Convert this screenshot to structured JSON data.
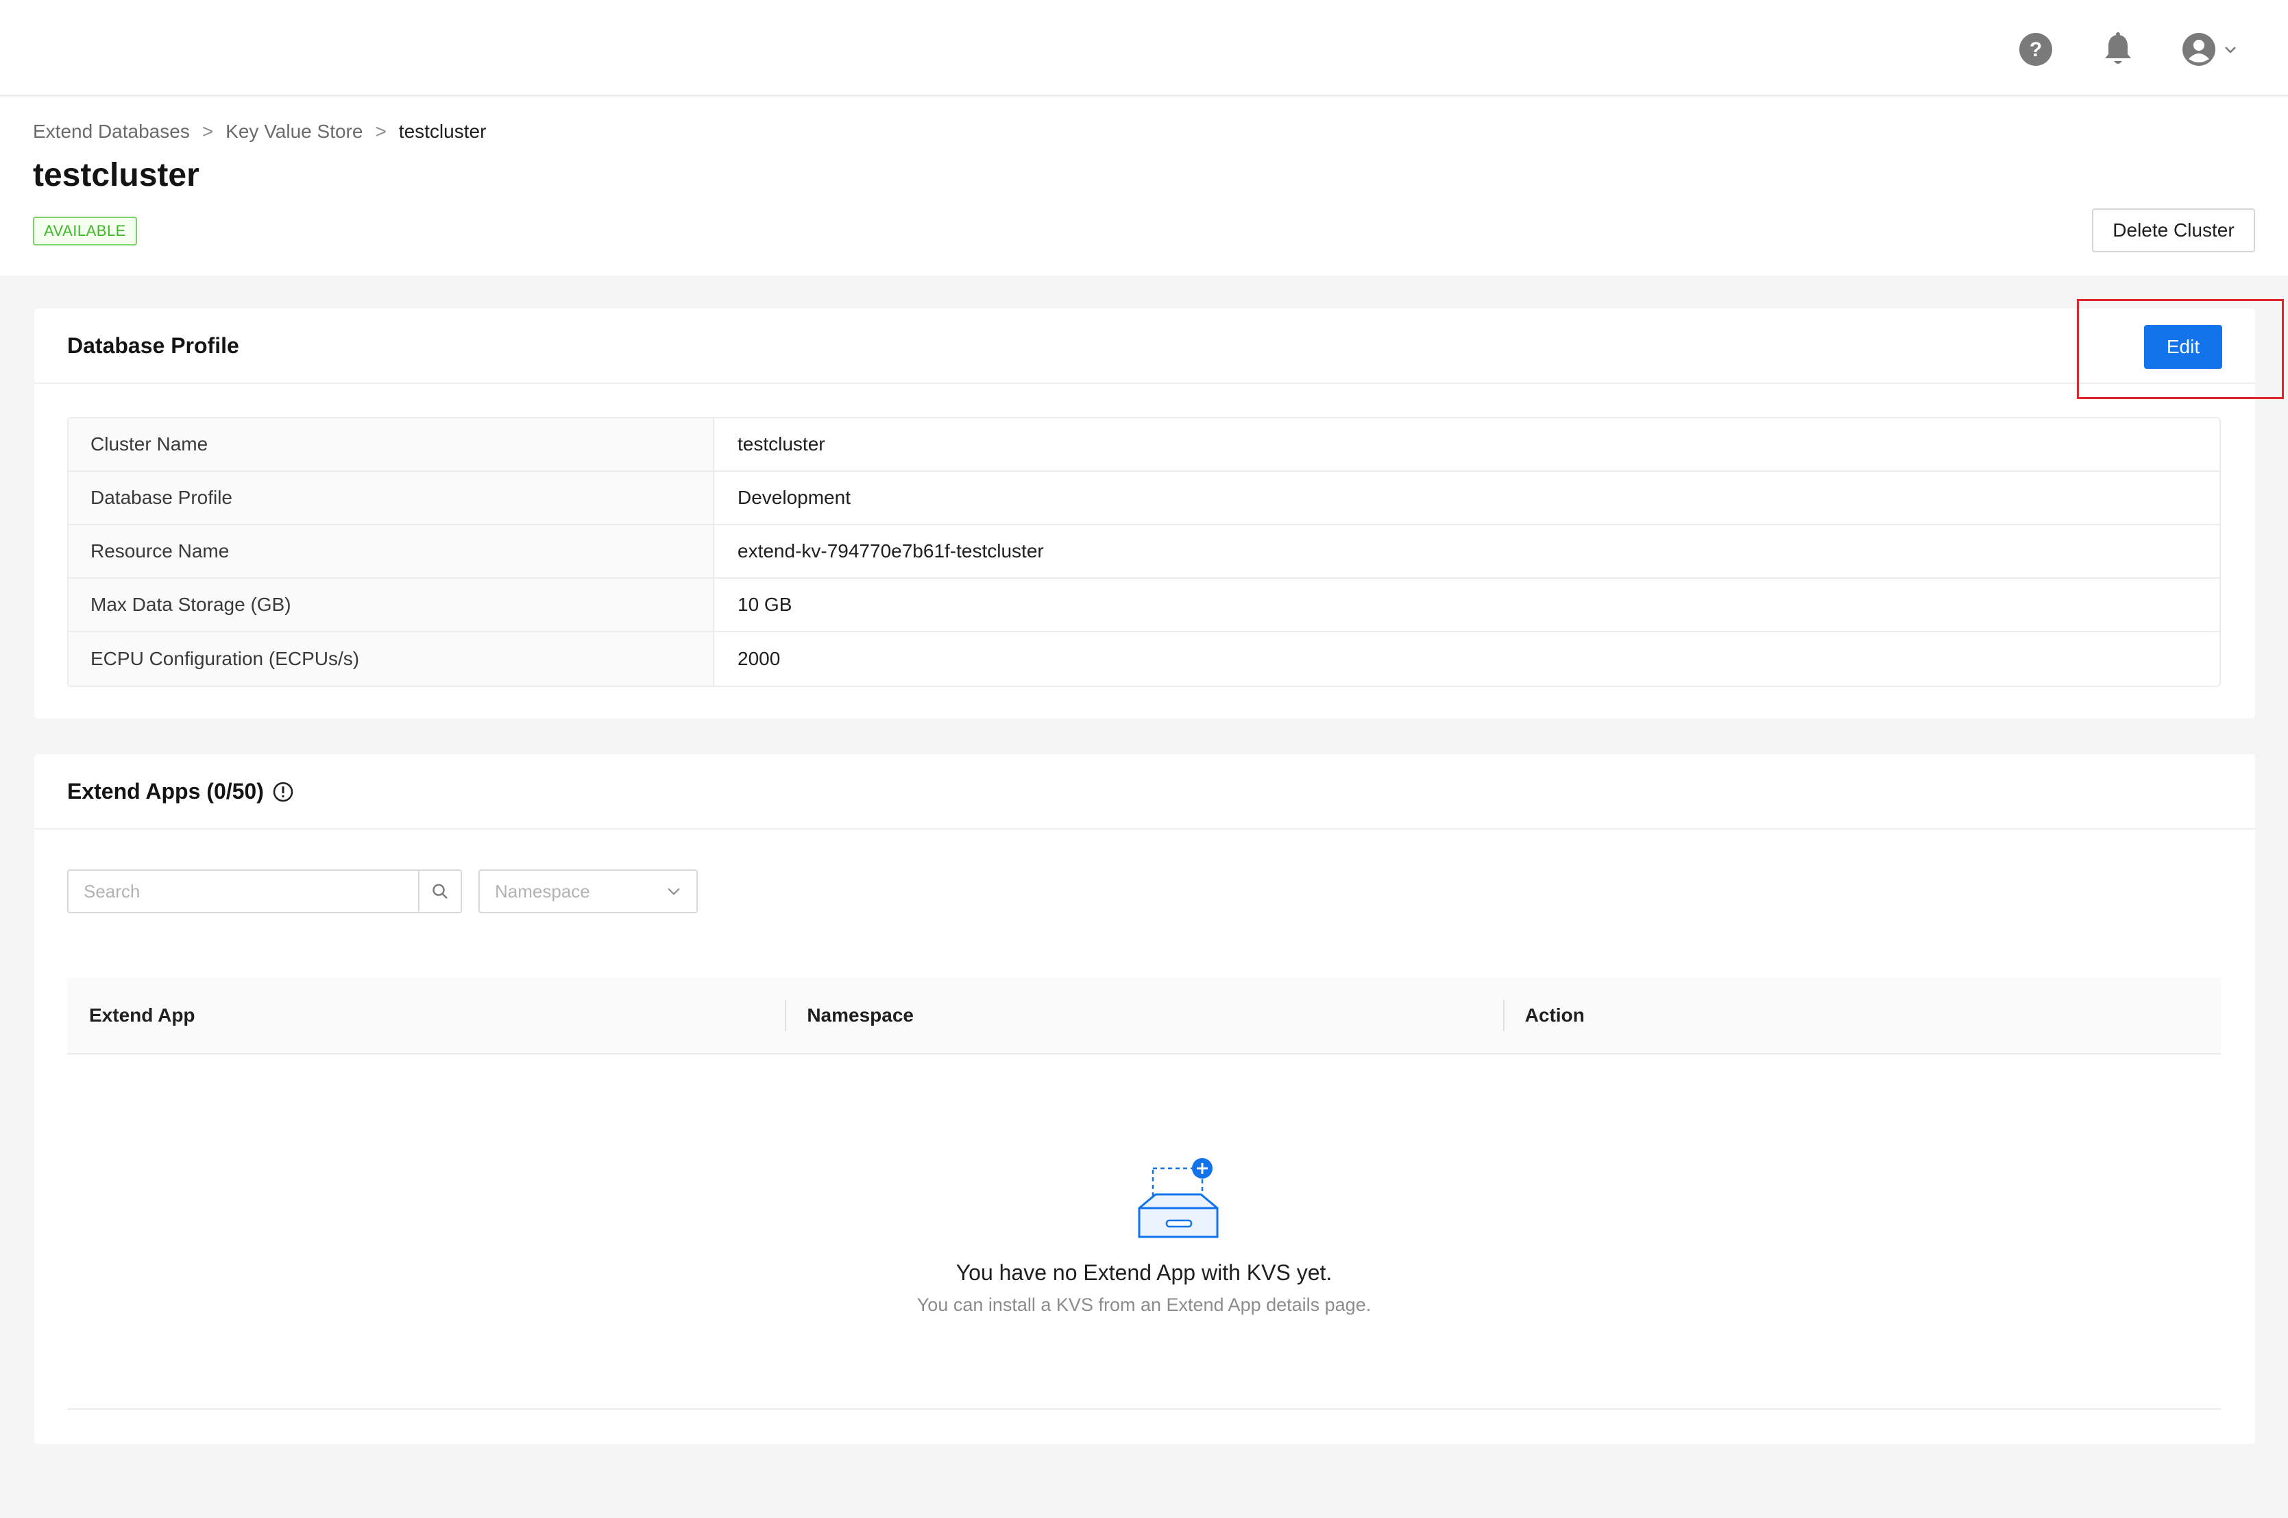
{
  "topbar": {
    "help_icon": "help-icon",
    "bell_icon": "bell-icon",
    "user_icon": "user-avatar-icon"
  },
  "breadcrumb": {
    "items": [
      "Extend Databases",
      "Key Value Store",
      "testcluster"
    ],
    "separator": ">"
  },
  "page": {
    "title": "testcluster",
    "status": "AVAILABLE",
    "delete_label": "Delete Cluster"
  },
  "profile": {
    "title": "Database Profile",
    "edit_label": "Edit",
    "rows": [
      {
        "label": "Cluster Name",
        "value": "testcluster"
      },
      {
        "label": "Database Profile",
        "value": "Development"
      },
      {
        "label": "Resource Name",
        "value": "extend-kv-794770e7b61f-testcluster"
      },
      {
        "label": "Max Data Storage (GB)",
        "value": "10 GB"
      },
      {
        "label": "ECPU Configuration (ECPUs/s)",
        "value": "2000"
      }
    ]
  },
  "apps": {
    "title": "Extend Apps (0/50)",
    "search_placeholder": "Search",
    "namespace_placeholder": "Namespace",
    "columns": [
      "Extend App",
      "Namespace",
      "Action"
    ],
    "empty_title": "You have no Extend App with KVS yet.",
    "empty_subtitle": "You can install a KVS from an Extend App details page."
  },
  "colors": {
    "primary": "#1273eb",
    "available": "#41b62a",
    "highlight": "#e0252b"
  }
}
